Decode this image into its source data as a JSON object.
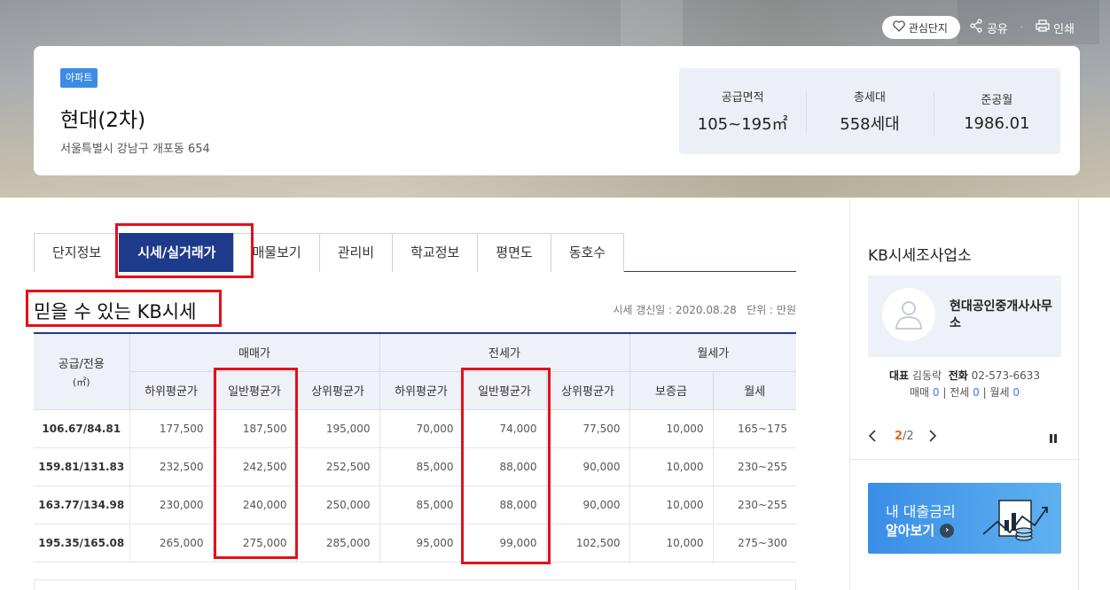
{
  "header": {
    "fav_label": "관심단지",
    "share_label": "공유",
    "print_label": "인쇄"
  },
  "property": {
    "badge": "아파트",
    "name": "현대(2차)",
    "address": "서울특별시 강남구 개포동 654",
    "stats": [
      {
        "label": "공급면적",
        "value": "105~195㎡"
      },
      {
        "label": "총세대",
        "value": "558세대"
      },
      {
        "label": "준공월",
        "value": "1986.01"
      }
    ]
  },
  "tabs": [
    "단지정보",
    "시세/실거래가",
    "매물보기",
    "관리비",
    "학교정보",
    "평면도",
    "동호수"
  ],
  "active_tab": "시세/실거래가",
  "section": {
    "title": "믿을 수 있는 KB시세",
    "meta": "시세 갱신일 : 2020.08.28   단위 : 만원"
  },
  "price_table": {
    "area_header_line1": "공급/전용",
    "area_header_line2": "(㎡)",
    "groups": [
      "매매가",
      "전세가",
      "월세가"
    ],
    "subheaders": [
      "하위평균가",
      "일반평균가",
      "상위평균가",
      "하위평균가",
      "일반평균가",
      "상위평균가",
      "보증금",
      "월세"
    ],
    "rows": [
      [
        "106.67/84.81",
        "177,500",
        "187,500",
        "195,000",
        "70,000",
        "74,000",
        "77,500",
        "10,000",
        "165~175"
      ],
      [
        "159.81/131.83",
        "232,500",
        "242,500",
        "252,500",
        "85,000",
        "88,000",
        "90,000",
        "10,000",
        "230~255"
      ],
      [
        "163.77/134.98",
        "230,000",
        "240,000",
        "250,000",
        "85,000",
        "88,000",
        "90,000",
        "10,000",
        "230~255"
      ],
      [
        "195.35/165.08",
        "265,000",
        "275,000",
        "285,000",
        "95,000",
        "99,000",
        "102,500",
        "10,000",
        "275~300"
      ]
    ]
  },
  "sidebar": {
    "title": "KB시세조사업소",
    "agent_name": "현대공인중개사사무소",
    "rep_label": "대표",
    "rep_name": "김동락",
    "phone_label": "전화",
    "phone": "02-573-6633",
    "count_sale_label": "매매",
    "count_sale": "0",
    "count_jeonse_label": "전세",
    "count_jeonse": "0",
    "count_monthly_label": "월세",
    "count_monthly": "0",
    "page_current": "2",
    "page_total": "/2",
    "loan_line1": "내 대출금리",
    "loan_line2": "알아보기"
  },
  "colors": {
    "navy": "#1e3a8a",
    "highlight_red": "#e3101b",
    "badge_blue": "#3c8ce7",
    "table_header_bg": "#eef1f7"
  }
}
